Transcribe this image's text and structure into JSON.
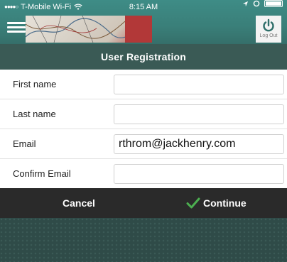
{
  "status_bar": {
    "carrier": "T-Mobile Wi-Fi",
    "time": "8:15 AM"
  },
  "header": {
    "logout_label": "Log Out"
  },
  "title": "User Registration",
  "form": {
    "fields": [
      {
        "label": "First name",
        "value": "",
        "placeholder": ""
      },
      {
        "label": "Last name",
        "value": "",
        "placeholder": ""
      },
      {
        "label": "Email",
        "value": "rthrom@jackhenry.com",
        "placeholder": ""
      },
      {
        "label": "Confirm Email",
        "value": "",
        "placeholder": ""
      }
    ]
  },
  "actions": {
    "cancel_label": "Cancel",
    "continue_label": "Continue"
  },
  "colors": {
    "header_teal": "#3a7f79",
    "title_bar": "#3a5a55",
    "action_bar": "#2a2a2a",
    "check_green": "#4caf50"
  }
}
